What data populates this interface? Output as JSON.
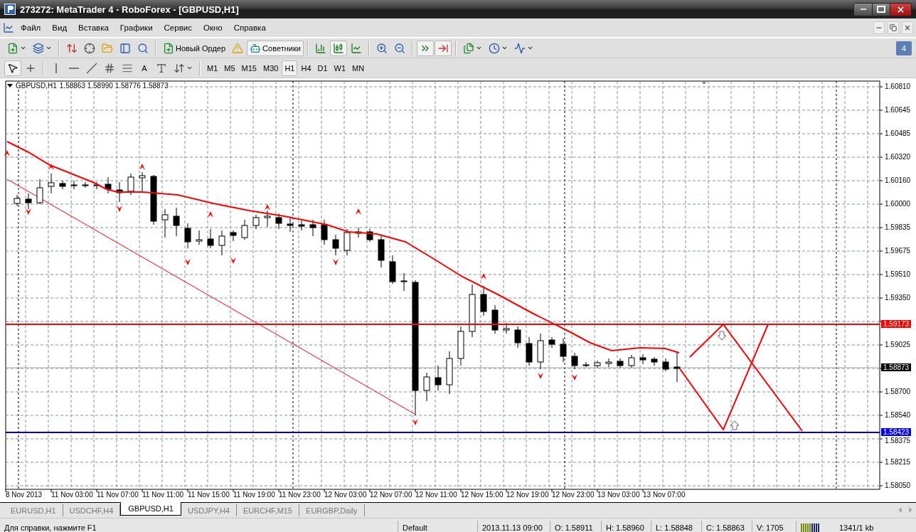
{
  "window": {
    "title": "273272: MetaTrader 4 - RoboForex - [GBPUSD,H1]"
  },
  "menu": [
    "Файл",
    "Вид",
    "Вставка",
    "Графики",
    "Сервис",
    "Окно",
    "Справка"
  ],
  "toolbar": [
    {
      "kind": "icon",
      "pressed": false,
      "dropdown": true
    },
    {
      "kind": "icon",
      "pressed": false,
      "dropdown": true
    },
    {
      "kind": "separator"
    },
    {
      "kind": "icon",
      "pressed": false
    },
    {
      "kind": "icon",
      "pressed": false
    },
    {
      "kind": "icon",
      "pressed": false
    },
    {
      "kind": "icon",
      "pressed": false
    },
    {
      "kind": "icon",
      "pressed": false
    },
    {
      "kind": "separator"
    },
    {
      "kind": "labeled",
      "label": "Новый Ордер",
      "pressed": false
    },
    {
      "kind": "icon",
      "pressed": false
    },
    {
      "kind": "labeled",
      "label": "Советники",
      "pressed": true
    },
    {
      "kind": "separator"
    },
    {
      "kind": "icon",
      "pressed": false
    },
    {
      "kind": "icon",
      "pressed": true
    },
    {
      "kind": "icon",
      "pressed": false
    },
    {
      "kind": "separator"
    },
    {
      "kind": "icon",
      "pressed": false
    },
    {
      "kind": "icon",
      "pressed": false
    },
    {
      "kind": "separator"
    },
    {
      "kind": "icon",
      "pressed": true
    },
    {
      "kind": "icon",
      "pressed": true
    },
    {
      "kind": "separator"
    },
    {
      "kind": "icon",
      "pressed": false,
      "dropdown": true
    },
    {
      "kind": "icon",
      "pressed": false,
      "dropdown": true
    },
    {
      "kind": "icon",
      "pressed": false,
      "dropdown": true
    }
  ],
  "notifications": {
    "count": "4"
  },
  "drawing_toolbar": {
    "tools": [
      {
        "kind": "icon",
        "pressed": true
      },
      {
        "kind": "icon",
        "pressed": false
      },
      {
        "kind": "separator"
      },
      {
        "kind": "icon",
        "pressed": false
      },
      {
        "kind": "icon",
        "pressed": false
      },
      {
        "kind": "icon",
        "pressed": false
      },
      {
        "kind": "icon",
        "pressed": false
      },
      {
        "kind": "icon",
        "pressed": false
      },
      {
        "kind": "text",
        "label": "A",
        "pressed": false
      },
      {
        "kind": "icon",
        "pressed": false
      },
      {
        "kind": "icon",
        "pressed": false,
        "dropdown": true
      }
    ],
    "timeframes": [
      {
        "label": "M1",
        "selected": false
      },
      {
        "label": "M5",
        "selected": false
      },
      {
        "label": "M15",
        "selected": false
      },
      {
        "label": "M30",
        "selected": false
      },
      {
        "label": "H1",
        "selected": true
      },
      {
        "label": "H4",
        "selected": false
      },
      {
        "label": "D1",
        "selected": false
      },
      {
        "label": "W1",
        "selected": false
      },
      {
        "label": "MN",
        "selected": false
      }
    ]
  },
  "chart": {
    "symbol": "GBPUSD,H1",
    "ohlc": "1.58863 1.58990 1.58776 1.58873",
    "price_labels": [
      "1.60810",
      "1.60645",
      "1.60485",
      "1.60320",
      "1.60160",
      "1.60000",
      "1.59835",
      "1.59675",
      "1.59510",
      "1.59350",
      "1.59025",
      "1.58700",
      "1.58540",
      "1.58375",
      "1.58215",
      "1.58050"
    ],
    "price_markers": [
      {
        "label": "1.59173",
        "color": "#ff0000"
      },
      {
        "label": "1.58873",
        "color": "#000000"
      },
      {
        "label": "1.58423",
        "color": "#0000ff"
      }
    ],
    "time_labels": [
      "8 Nov 2013",
      "11 Nov 03:00",
      "11 Nov 07:00",
      "11 Nov 11:00",
      "11 Nov 15:00",
      "11 Nov 19:00",
      "11 Nov 23:00",
      "12 Nov 03:00",
      "12 Nov 07:00",
      "12 Nov 11:00",
      "12 Nov 15:00",
      "12 Nov 19:00",
      "12 Nov 23:00",
      "13 Nov 03:00",
      "13 Nov 07:00"
    ]
  },
  "tabs": [
    {
      "label": "EURUSD,H1",
      "selected": false
    },
    {
      "label": "USDCHF,H4",
      "selected": false
    },
    {
      "label": "GBPUSD,H1",
      "selected": true
    },
    {
      "label": "USDJPY,H4",
      "selected": false
    },
    {
      "label": "EURCHF,M15",
      "selected": false
    },
    {
      "label": "EURGBP,Daily",
      "selected": false
    }
  ],
  "status_bar": {
    "help": "Для справки, нажмите F1",
    "profile": "Default",
    "fields": [
      "2013.11.13 09:00",
      "O: 1.58911",
      "H: 1.58960",
      "L: 1.58848",
      "C: 1.58863",
      "V: 1705"
    ],
    "traffic": "1341/1 kb"
  }
}
